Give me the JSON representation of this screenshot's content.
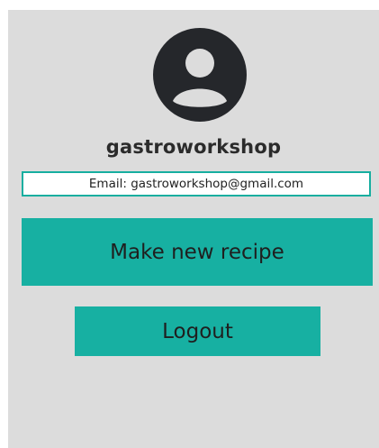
{
  "profile": {
    "avatar_icon": "user-circle-icon",
    "username": "gastroworkshop",
    "email_text": "Email: gastroworkshop@gmail.com"
  },
  "actions": {
    "new_recipe_label": "Make new recipe",
    "logout_label": "Logout"
  },
  "colors": {
    "panel_bg": "#dcdcdc",
    "accent": "#17b0a2",
    "icon": "#25272b"
  }
}
